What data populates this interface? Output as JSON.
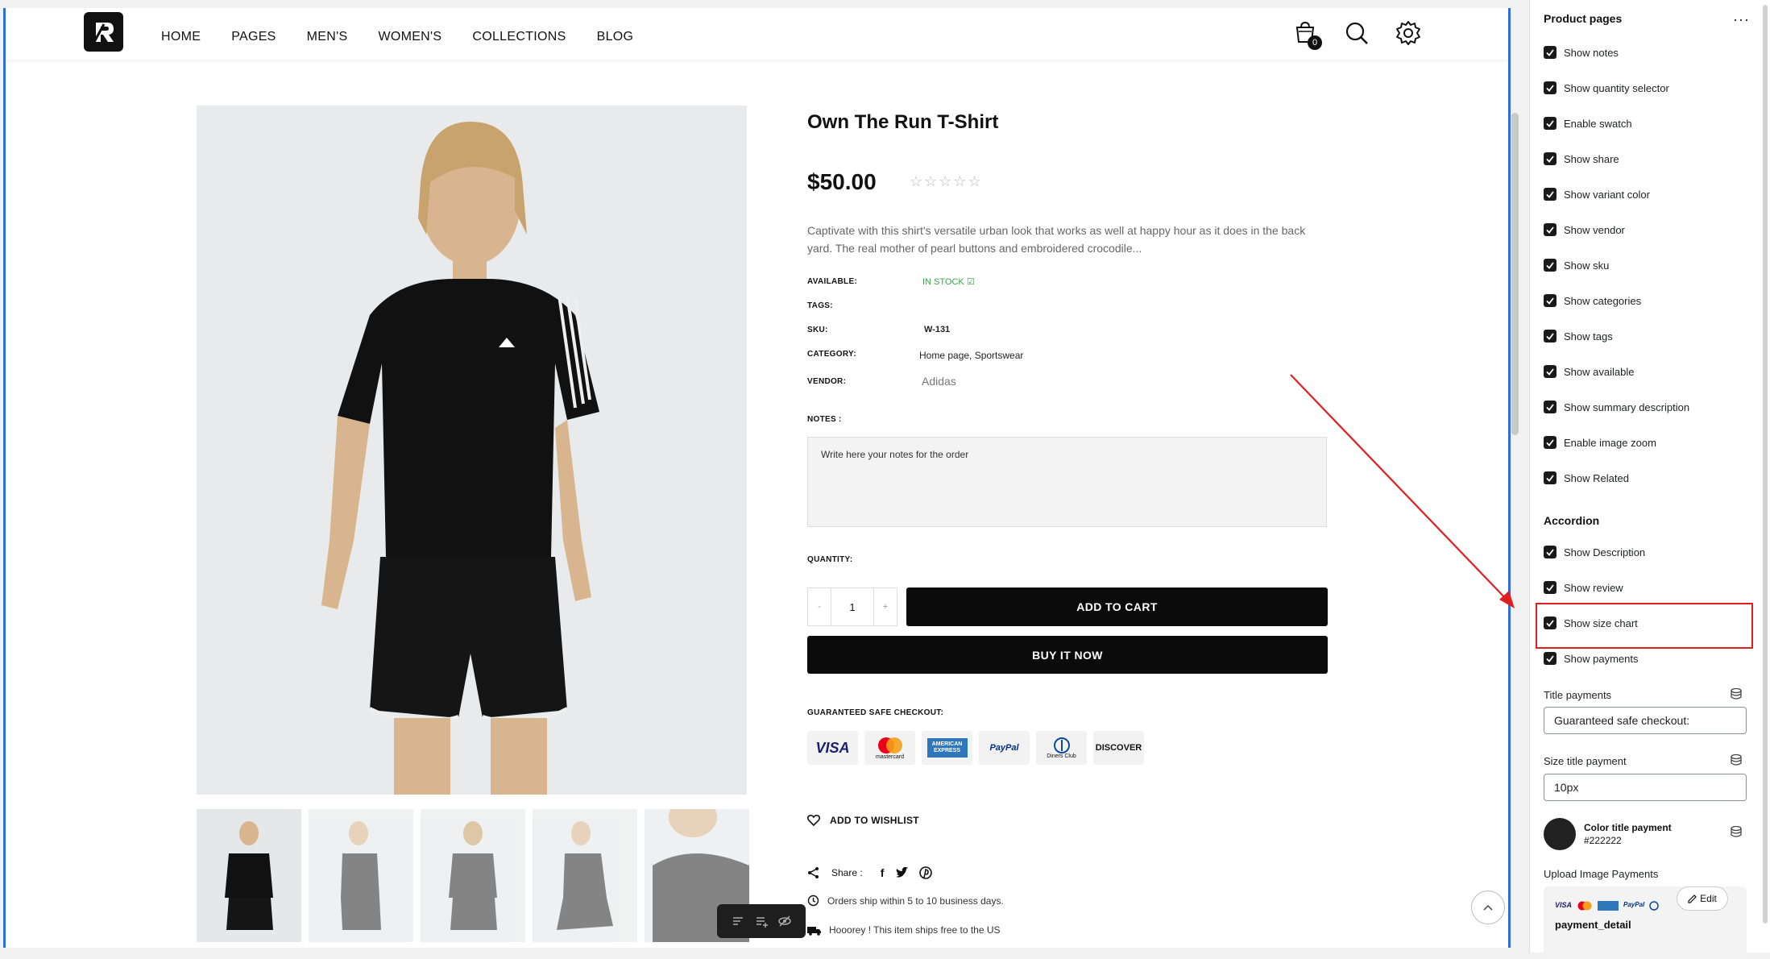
{
  "nav": {
    "items": [
      "HOME",
      "PAGES",
      "MEN'S",
      "WOMEN'S",
      "COLLECTIONS",
      "BLOG"
    ],
    "cart_count": "0"
  },
  "product": {
    "title": "Own The Run T-Shirt",
    "price": "$50.00",
    "stars": "☆☆☆☆☆",
    "description": "Captivate with this shirt's versatile urban look that works as well at happy hour as it does in the back yard. The real mother of pearl buttons and embroidered crocodile...",
    "meta": {
      "available_label": "AVAILABLE:",
      "available_value": "IN STOCK",
      "tags_label": "TAGS:",
      "sku_label": "SKU:",
      "sku_value": "W-131",
      "category_label": "CATEGORY:",
      "category_value": "Home page, Sportswear",
      "vendor_label": "VENDOR:",
      "vendor_value": "Adidas"
    },
    "notes_label": "NOTES :",
    "notes_placeholder": "Write here your notes for the order",
    "quantity_label": "QUANTITY:",
    "qty_minus": "-",
    "qty_value": "1",
    "qty_plus": "+",
    "add_to_cart": "ADD TO CART",
    "buy_now": "BUY IT NOW",
    "safe_checkout": "GUARANTEED SAFE CHECKOUT:",
    "payment_methods": [
      "VISA",
      "mastercard",
      "AMERICAN EXPRESS",
      "PayPal",
      "Diners Club",
      "DISCOVER"
    ],
    "wishlist": "ADD TO WISHLIST",
    "share_label": "Share :",
    "ship_time": "Orders ship within 5 to 10 business days.",
    "ship_free": "Hooorey ! This item ships free to the US"
  },
  "panel": {
    "section_title": "Product pages",
    "product_checkboxes": [
      "Show notes",
      "Show quantity selector",
      "Enable swatch",
      "Show share",
      "Show variant color",
      "Show vendor",
      "Show sku",
      "Show categories",
      "Show tags",
      "Show available",
      "Show summary description",
      "Enable image zoom",
      "Show Related"
    ],
    "accordion_title": "Accordion",
    "accordion_checkboxes": [
      "Show Description",
      "Show review",
      "Show size chart",
      "Show payments"
    ],
    "title_payments_label": "Title payments",
    "title_payments_value": "Guaranteed safe checkout:",
    "size_title_label": "Size title payment",
    "size_title_value": "10px",
    "color_title_label": "Color title payment",
    "color_title_value": "#222222",
    "upload_label": "Upload Image Payments",
    "edit_label": "Edit",
    "image_name": "payment_detail"
  },
  "colors": {
    "accent": "#2e6be6",
    "highlight": "#e02020",
    "in_stock": "#3aa34d"
  }
}
